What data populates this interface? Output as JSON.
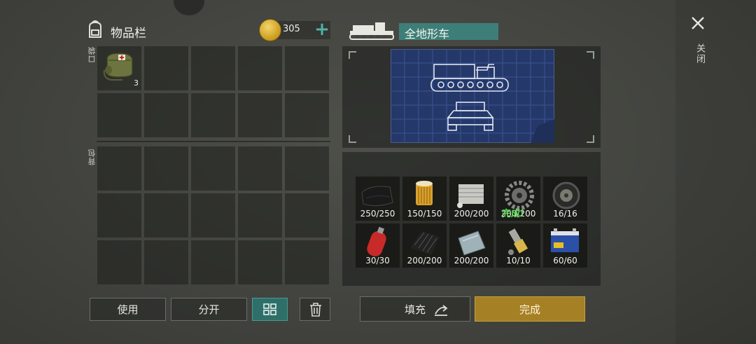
{
  "inventory": {
    "title": "物品栏",
    "coins": "305",
    "pocket_label": "口袋",
    "backpack_label": "背包",
    "pocket_items": [
      {
        "slot": 0,
        "icon": "medkit-bag-icon",
        "count": "3"
      }
    ]
  },
  "vehicle": {
    "title": "全地形车"
  },
  "materials": [
    {
      "icon": "tarp-icon",
      "count": "250/250"
    },
    {
      "icon": "air-filter-icon",
      "count": "150/150"
    },
    {
      "icon": "engine-block-icon",
      "count": "200/200"
    },
    {
      "icon": "gear-icon",
      "count": "200/200",
      "overlay": "完成!"
    },
    {
      "icon": "wheel-icon",
      "count": "16/16"
    },
    {
      "icon": "gas-canister-icon",
      "count": "30/30"
    },
    {
      "icon": "carbon-plate-icon",
      "count": "200/200"
    },
    {
      "icon": "steel-sheet-icon",
      "count": "200/200"
    },
    {
      "icon": "shock-absorber-icon",
      "count": "10/10"
    },
    {
      "icon": "battery-icon",
      "count": "60/60"
    }
  ],
  "buttons": {
    "use": "使用",
    "split": "分开",
    "fill": "填充",
    "done": "完成"
  },
  "close": {
    "label": "关闭"
  },
  "colors": {
    "accent": "#3e7e78",
    "done": "#a68024",
    "blueprint": "#25386a"
  }
}
